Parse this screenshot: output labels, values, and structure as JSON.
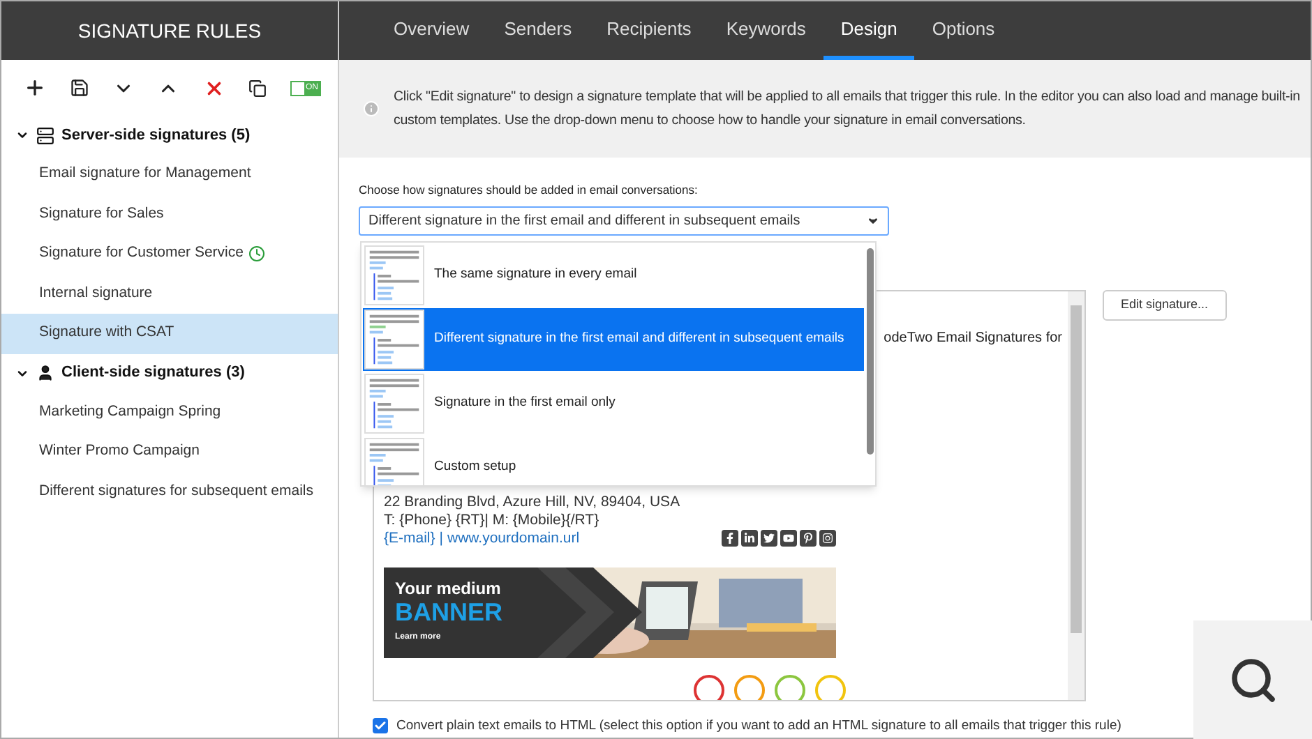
{
  "sidebar": {
    "title": "SIGNATURE RULES",
    "toggle": {
      "label": "ON",
      "on": true
    },
    "groups": [
      {
        "label": "Server-side signatures (5)",
        "kind": "server",
        "expanded": true,
        "items": [
          {
            "label": "Email signature for Management",
            "selected": false,
            "scheduled": false
          },
          {
            "label": "Signature for Sales",
            "selected": false,
            "scheduled": false
          },
          {
            "label": "Signature for Customer Service",
            "selected": false,
            "scheduled": true
          },
          {
            "label": "Internal signature",
            "selected": false,
            "scheduled": false
          },
          {
            "label": "Signature with CSAT",
            "selected": true,
            "scheduled": false
          }
        ]
      },
      {
        "label": "Client-side signatures (3)",
        "kind": "client",
        "expanded": true,
        "items": [
          {
            "label": "Marketing Campaign Spring",
            "selected": false,
            "scheduled": false
          },
          {
            "label": "Winter Promo Campaign",
            "selected": false,
            "scheduled": false
          },
          {
            "label": "Different signatures for subsequent emails",
            "selected": false,
            "scheduled": false
          }
        ]
      }
    ]
  },
  "tabs": [
    {
      "label": "Overview",
      "selected": false
    },
    {
      "label": "Senders",
      "selected": false
    },
    {
      "label": "Recipients",
      "selected": false
    },
    {
      "label": "Keywords",
      "selected": false
    },
    {
      "label": "Design",
      "selected": true
    },
    {
      "label": "Options",
      "selected": false
    }
  ],
  "info": {
    "lines": [
      "Click \"Edit signature\" to design a signature template that will be applied to all emails that trigger this rule. In the editor you can also load and manage built-in",
      "custom templates. Use the drop-down menu to choose how to handle your signature in email conversations."
    ]
  },
  "mode": {
    "label": "Choose how signatures should be added in email conversations:",
    "value": "Different signature in the first email and different in subsequent emails",
    "open": true,
    "options": [
      {
        "label": "The same signature in every email",
        "selected": false
      },
      {
        "label": "Different signature in the first email and different in subsequent emails",
        "selected": true
      },
      {
        "label": "Signature in the first email only",
        "selected": false
      },
      {
        "label": "Custom setup",
        "selected": false
      }
    ]
  },
  "preview": {
    "fragment": "odeTwo Email Signatures for",
    "address": "22 Branding Blvd, Azure Hill, NV, 89404, USA",
    "phone": "T: {Phone} {RT}| M: {Mobile}{/RT}",
    "email": "{E-mail}",
    "separator": "|",
    "website": "www.yourdomain.url",
    "banner": {
      "line1": "Your medium",
      "line2": "BANNER",
      "link": "Learn more"
    }
  },
  "edit_button": "Edit signature...",
  "convert": {
    "label": "Convert plain text emails to HTML (select this option if you want to add an HTML signature to all emails that trigger this rule)",
    "checked": true
  }
}
